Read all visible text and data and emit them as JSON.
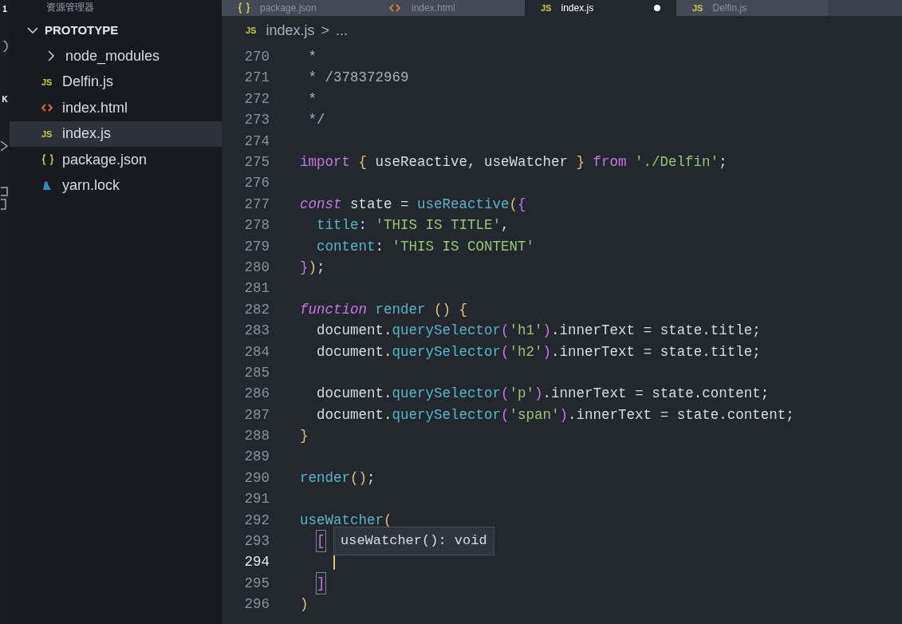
{
  "activity_bar": {
    "badge": "1",
    "label": "K"
  },
  "sidebar": {
    "title": "资源管理器",
    "section": {
      "label": "PROTOTYPE",
      "expanded": true
    },
    "items": [
      {
        "kind": "folder",
        "label": "node_modules",
        "expanded": false,
        "selected": false
      },
      {
        "kind": "js",
        "icon": "JS",
        "label": "Delfin.js",
        "selected": false
      },
      {
        "kind": "html",
        "label": "index.html",
        "selected": false
      },
      {
        "kind": "js",
        "icon": "JS",
        "label": "index.js",
        "selected": true
      },
      {
        "kind": "json",
        "label": "package.json",
        "selected": false
      },
      {
        "kind": "yarn",
        "label": "yarn.lock",
        "selected": false
      }
    ]
  },
  "tabs": [
    {
      "kind": "json",
      "label": "package.json",
      "selected": false,
      "modified": false
    },
    {
      "kind": "html",
      "label": "index.html",
      "selected": false,
      "modified": false
    },
    {
      "kind": "js",
      "icon": "JS",
      "label": "index.js",
      "selected": true,
      "modified": true
    },
    {
      "kind": "js",
      "icon": "JS",
      "label": "Delfin.js",
      "selected": false,
      "modified": false
    }
  ],
  "breadcrumb": {
    "kind": "js",
    "icon": "JS",
    "file": "index.js",
    "separator": ">",
    "rest": "..."
  },
  "code": {
    "lines": [
      {
        "number": "270",
        "tokens": [
          {
            "kind": "comment",
            "text": " *"
          }
        ]
      },
      {
        "number": "271",
        "tokens": [
          {
            "kind": "comment",
            "text": " * /378372969"
          }
        ]
      },
      {
        "number": "272",
        "tokens": [
          {
            "kind": "comment",
            "text": " *"
          }
        ]
      },
      {
        "number": "273",
        "tokens": [
          {
            "kind": "comment",
            "text": " */"
          }
        ]
      },
      {
        "number": "274"
      },
      {
        "number": "275",
        "tokens": [
          {
            "kind": "keyword",
            "text": "import"
          },
          {
            "kind": "brace",
            "text": " {"
          },
          {
            "kind": "plain",
            "text": " useReactive, useWatcher "
          },
          {
            "kind": "brace",
            "text": "}"
          },
          {
            "kind": "keyword",
            "text": " from"
          },
          {
            "kind": "string",
            "text": " './Delfin'"
          },
          {
            "kind": "plain",
            "text": ";"
          }
        ]
      },
      {
        "number": "276"
      },
      {
        "number": "277",
        "tokens": [
          {
            "kind": "storage",
            "text": "const"
          },
          {
            "kind": "plain",
            "text": " state = "
          },
          {
            "kind": "function",
            "text": "useReactive"
          },
          {
            "kind": "brace",
            "text": "("
          },
          {
            "kind": "bracket2",
            "text": "{"
          }
        ]
      },
      {
        "number": "278",
        "tokens": [
          {
            "kind": "property",
            "text": "  title"
          },
          {
            "kind": "plain",
            "text": ": "
          },
          {
            "kind": "string",
            "text": "'THIS IS TITLE'"
          },
          {
            "kind": "plain",
            "text": ","
          }
        ]
      },
      {
        "number": "279",
        "tokens": [
          {
            "kind": "property",
            "text": "  content"
          },
          {
            "kind": "plain",
            "text": ": "
          },
          {
            "kind": "string",
            "text": "'THIS IS CONTENT'"
          }
        ]
      },
      {
        "number": "280",
        "tokens": [
          {
            "kind": "bracket2",
            "text": "}"
          },
          {
            "kind": "brace",
            "text": ")"
          },
          {
            "kind": "plain",
            "text": ";"
          }
        ]
      },
      {
        "number": "281"
      },
      {
        "number": "282",
        "tokens": [
          {
            "kind": "storage",
            "text": "function"
          },
          {
            "kind": "function",
            "text": " render"
          },
          {
            "kind": "brace",
            "text": " ()"
          },
          {
            "kind": "brace",
            "text": " {"
          }
        ]
      },
      {
        "number": "283",
        "tokens": [
          {
            "kind": "plain",
            "text": "  document."
          },
          {
            "kind": "function",
            "text": "querySelector"
          },
          {
            "kind": "bracket2",
            "text": "("
          },
          {
            "kind": "string",
            "text": "'h1'"
          },
          {
            "kind": "bracket2",
            "text": ")"
          },
          {
            "kind": "plain",
            "text": ".innerText = state.title;"
          }
        ]
      },
      {
        "number": "284",
        "tokens": [
          {
            "kind": "plain",
            "text": "  document."
          },
          {
            "kind": "function",
            "text": "querySelector"
          },
          {
            "kind": "bracket2",
            "text": "("
          },
          {
            "kind": "string",
            "text": "'h2'"
          },
          {
            "kind": "bracket2",
            "text": ")"
          },
          {
            "kind": "plain",
            "text": ".innerText = state.title;"
          }
        ]
      },
      {
        "number": "285"
      },
      {
        "number": "286",
        "tokens": [
          {
            "kind": "plain",
            "text": "  document."
          },
          {
            "kind": "function",
            "text": "querySelector"
          },
          {
            "kind": "bracket2",
            "text": "("
          },
          {
            "kind": "string",
            "text": "'p'"
          },
          {
            "kind": "bracket2",
            "text": ")"
          },
          {
            "kind": "plain",
            "text": ".innerText = state.content;"
          }
        ]
      },
      {
        "number": "287",
        "tokens": [
          {
            "kind": "plain",
            "text": "  document."
          },
          {
            "kind": "function",
            "text": "querySelector"
          },
          {
            "kind": "bracket2",
            "text": "("
          },
          {
            "kind": "string",
            "text": "'span'"
          },
          {
            "kind": "bracket2",
            "text": ")"
          },
          {
            "kind": "plain",
            "text": ".innerText = state.content;"
          }
        ]
      },
      {
        "number": "288",
        "tokens": [
          {
            "kind": "brace",
            "text": "}"
          }
        ]
      },
      {
        "number": "289"
      },
      {
        "number": "290",
        "tokens": [
          {
            "kind": "function",
            "text": "render"
          },
          {
            "kind": "brace",
            "text": "()"
          },
          {
            "kind": "plain",
            "text": ";"
          }
        ]
      },
      {
        "number": "291"
      },
      {
        "number": "292",
        "tokens": [
          {
            "kind": "function",
            "text": "useWatcher"
          },
          {
            "kind": "brace",
            "text": "("
          }
        ]
      },
      {
        "number": "293",
        "tokens": [
          {
            "kind": "matched",
            "text": "["
          }
        ]
      },
      {
        "number": "294",
        "cursor": true
      },
      {
        "number": "295",
        "tokens": [
          {
            "kind": "matched",
            "text": "]"
          }
        ]
      },
      {
        "number": "296",
        "tokens": [
          {
            "kind": "brace",
            "text": ")"
          }
        ]
      }
    ]
  },
  "tooltip": {
    "text": "useWatcher(): void"
  }
}
